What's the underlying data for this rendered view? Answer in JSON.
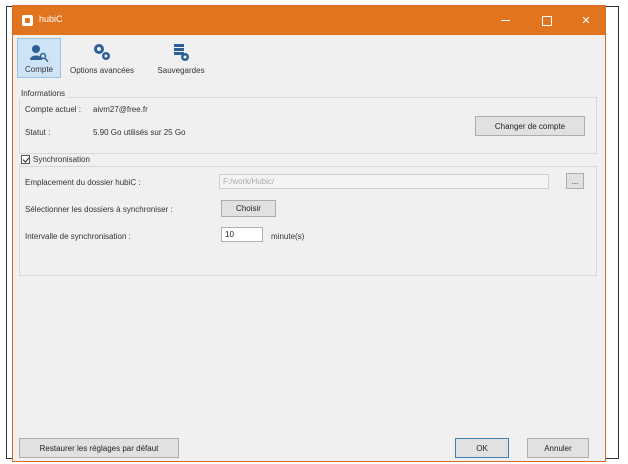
{
  "window": {
    "title": "hubiC",
    "accent_color": "#e0741f"
  },
  "toolbar": {
    "tabs": [
      {
        "label": "Compte",
        "icon": "user-key-icon",
        "active": true
      },
      {
        "label": "Options avancées",
        "icon": "gears-icon",
        "active": false
      },
      {
        "label": "Sauvegardes",
        "icon": "backup-icon",
        "active": false
      }
    ]
  },
  "info": {
    "group_title": "Informations",
    "account_label": "Compte actuel :",
    "account_value": "aivm27@free.fr",
    "status_label": "Statut :",
    "status_value": "5.90 Go utilisés sur 25 Go",
    "change_account_button": "Changer de compte"
  },
  "sync": {
    "checkbox_label": "Synchronisation",
    "checked": true,
    "folder_label": "Emplacement du dossier hubiC :",
    "folder_value": "F:/work/Hubic/",
    "browse_button": "...",
    "select_label": "Sélectionner les dossiers à synchroniser :",
    "choose_button": "Choisir",
    "interval_label": "Intervalle de synchronisation :",
    "interval_value": "10",
    "interval_unit": "minute(s)"
  },
  "footer": {
    "restore_button": "Restaurer les réglages par défaut",
    "ok_button": "OK",
    "cancel_button": "Annuler"
  }
}
